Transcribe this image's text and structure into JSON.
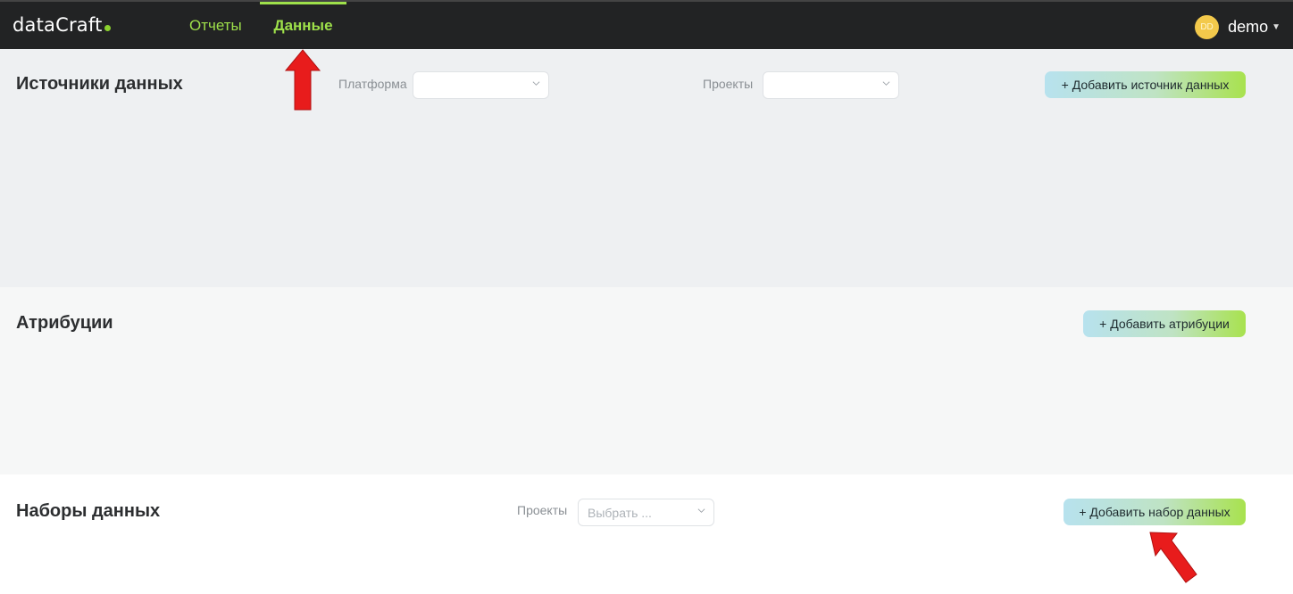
{
  "nav": {
    "logo": "dataCraft",
    "tabs": [
      {
        "label": "Отчеты",
        "active": false
      },
      {
        "label": "Данные",
        "active": true
      }
    ],
    "user": {
      "initials": "DD",
      "name": "demo"
    }
  },
  "sources": {
    "title": "Источники данных",
    "platform_label": "Платформа",
    "platform_value": "",
    "projects_label": "Проекты",
    "projects_value": "",
    "add_button": "+ Добавить источник данных"
  },
  "attributions": {
    "title": "Атрибуции",
    "add_button": "+ Добавить атрибуции"
  },
  "datasets": {
    "title": "Наборы данных",
    "projects_label": "Проекты",
    "projects_placeholder": "Выбрать ...",
    "add_button": "+ Добавить набор данных"
  },
  "colors": {
    "nav_bg": "#222324",
    "accent_green": "#9ee04a",
    "annotation_red": "#e81c1c"
  }
}
